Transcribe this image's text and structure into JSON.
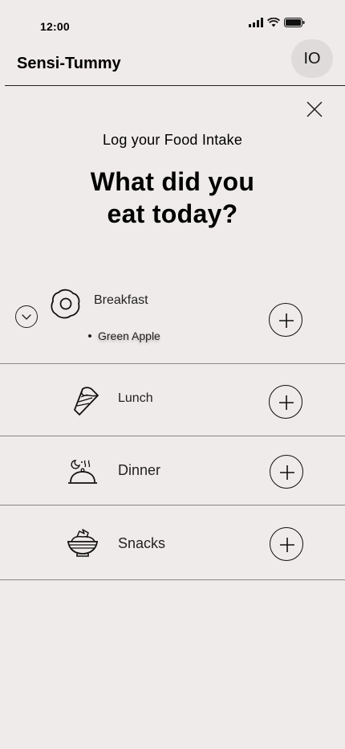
{
  "status_bar": {
    "time": "12:00"
  },
  "header": {
    "app_title": "Sensi-Tummy",
    "avatar_initials": "IO"
  },
  "page": {
    "subtitle": "Log your Food Intake",
    "headline": "What did you\n eat today?"
  },
  "meals": [
    {
      "label": "Breakfast",
      "icon": "fried-egg-icon",
      "items": [
        "Green Apple"
      ],
      "expanded": true
    },
    {
      "label": "Lunch",
      "icon": "sandwich-icon",
      "items": []
    },
    {
      "label": "Dinner",
      "icon": "cloche-icon",
      "items": []
    },
    {
      "label": "Snacks",
      "icon": "bowl-icon",
      "items": []
    }
  ],
  "colors": {
    "background": "#efebea",
    "avatar_bg": "#dedbda",
    "divider": "#8a8787"
  }
}
